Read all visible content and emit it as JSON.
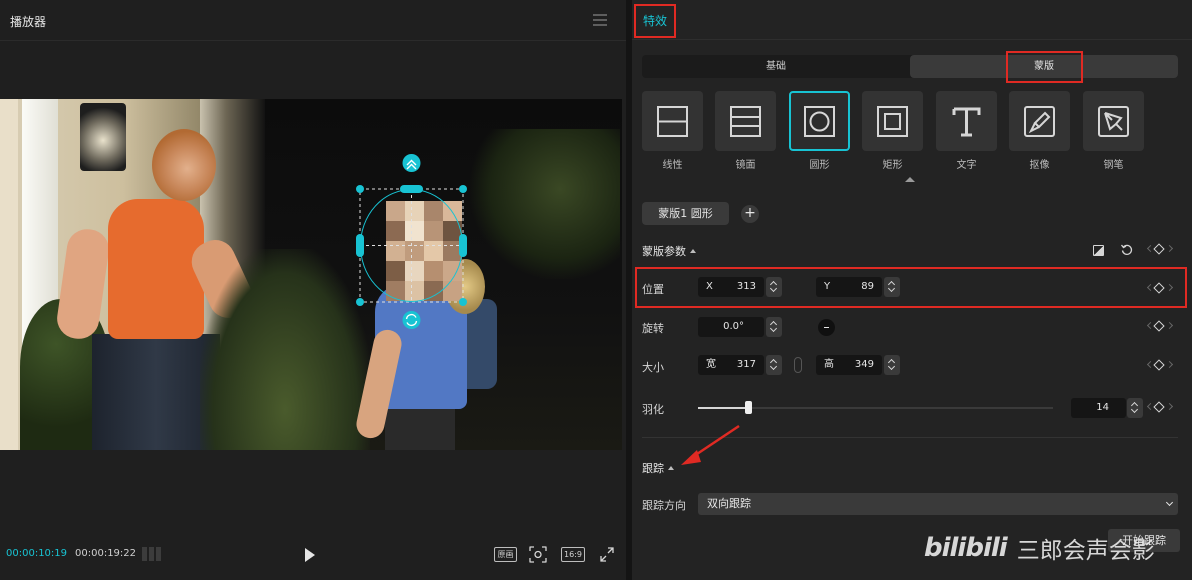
{
  "player": {
    "title": "播放器",
    "time_current": "00:00:10:19",
    "time_total": "00:00:19:22",
    "ratio_original_label": "原画",
    "ratio_16_9_label": "16:9"
  },
  "effects": {
    "tab_label": "特效",
    "subtabs": {
      "basic": "基础",
      "mask": "蒙版"
    },
    "mask_types": [
      {
        "label": "线性",
        "icon": "linear-mask-icon"
      },
      {
        "label": "镜面",
        "icon": "mirror-mask-icon"
      },
      {
        "label": "圆形",
        "icon": "circle-mask-icon",
        "selected": true
      },
      {
        "label": "矩形",
        "icon": "rectangle-mask-icon"
      },
      {
        "label": "文字",
        "icon": "text-mask-icon"
      },
      {
        "label": "抠像",
        "icon": "cutout-mask-icon"
      },
      {
        "label": "钢笔",
        "icon": "pen-mask-icon"
      }
    ],
    "mask_chip": "蒙版1 圆形",
    "params_title": "蒙版参数",
    "position": {
      "label": "位置",
      "x_prefix": "X",
      "x": "313",
      "y_prefix": "Y",
      "y": "89"
    },
    "rotation": {
      "label": "旋转",
      "value": "0.0°"
    },
    "size": {
      "label": "大小",
      "w_prefix": "宽",
      "w": "317",
      "h_prefix": "高",
      "h": "349"
    },
    "feather": {
      "label": "羽化",
      "value": "14",
      "fraction": 0.14
    },
    "tracking_title": "跟踪",
    "tracking_dir_label": "跟踪方向",
    "tracking_dir_value": "双向跟踪",
    "start_tracking_label": "开始跟踪"
  },
  "watermark": {
    "logo": "bilibili",
    "text": "三郎会声会影"
  },
  "colors": {
    "accent": "#18c3d3",
    "highlight_box": "#e02a23",
    "panel_bg": "#232323"
  }
}
